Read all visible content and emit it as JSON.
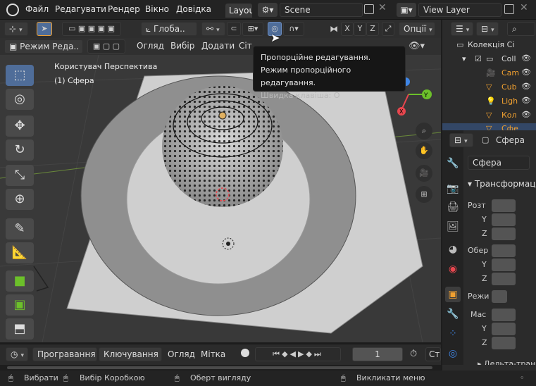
{
  "menu": {
    "file": "Файл",
    "edit": "Редагувати",
    "render": "Рендер",
    "window": "Вікно",
    "help": "Довідка"
  },
  "workspace_tab": "Layou",
  "scene": {
    "value": "Scene"
  },
  "view_layer": {
    "value": "View Layer"
  },
  "header": {
    "orientation": "Глоба..",
    "options": "Опції",
    "axis_x": "X",
    "axis_y": "Y",
    "axis_z": "Z",
    "mode": "Режим Реда..",
    "view": "Огляд",
    "select": "Вибір",
    "add": "Додати",
    "mesh": "Сіт"
  },
  "viewport": {
    "perspective": "Користувач Перспектива",
    "object": "(1) Сфера"
  },
  "tooltip": {
    "title": "Пропорційне редагування.",
    "desc": "Режим пропорційного редагування.",
    "shortcut": "Швидка клавіша: O"
  },
  "outliner": {
    "collection": "Колекція Сі",
    "items": [
      "Coll",
      "Cam",
      "Cub",
      "Ligh",
      "Кол",
      "Сфе"
    ]
  },
  "properties": {
    "object_name": "Сфера",
    "datablock": "Сфера",
    "section": "Трансформац",
    "location": "Розт",
    "rotation": "Обер",
    "mode": "Режи",
    "scale": "Мас",
    "y": "Y",
    "z": "Z",
    "delta": "Дельта-тран"
  },
  "timeline": {
    "playback": "Програвання",
    "keying": "Ключування",
    "view": "Огляд",
    "marker": "Мітка",
    "frame": "1",
    "start": "Ст"
  },
  "status": {
    "select": "Вибрати",
    "box_select": "Вибір Коробкою",
    "rotate_view": "Оберт вигляду",
    "context_menu": "Викликати меню"
  },
  "colors": {
    "accent": "#4f6d99",
    "x_axis": "#e8464e",
    "y_axis": "#6cc02a",
    "z_axis": "#3f86e6",
    "active_orange": "#f0a030"
  }
}
